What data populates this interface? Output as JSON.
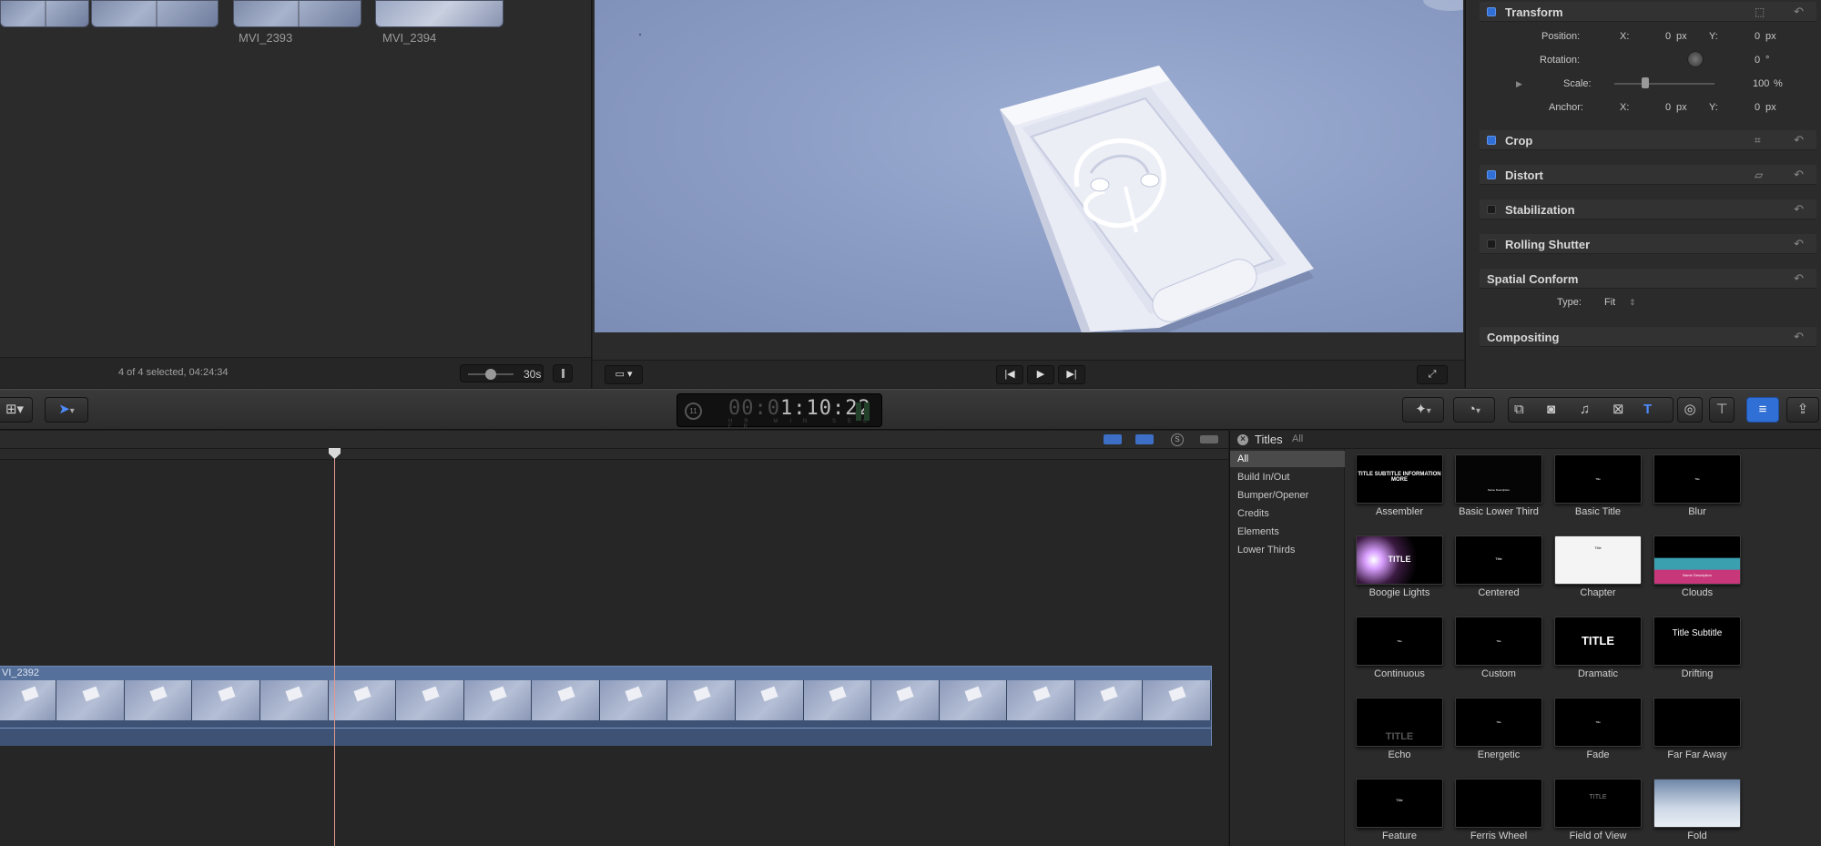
{
  "browser": {
    "clips": [
      {
        "name": ""
      },
      {
        "name": ""
      },
      {
        "name": "MVI_2393"
      },
      {
        "name": "MVI_2394"
      }
    ],
    "status": "4 of 4 selected, 04:24:34",
    "zoom_label": "30s"
  },
  "viewer": {
    "playback": {
      "prev": "|◀",
      "play": "▶",
      "next": "▶|"
    }
  },
  "inspector": {
    "transform": {
      "title": "Transform",
      "position_label": "Position:",
      "position_x_label": "X:",
      "position_x": "0",
      "position_x_unit": "px",
      "position_y_label": "Y:",
      "position_y": "0",
      "position_y_unit": "px",
      "rotation_label": "Rotation:",
      "rotation": "0",
      "rotation_unit": "°",
      "scale_label": "Scale:",
      "scale": "100",
      "scale_unit": "%",
      "anchor_label": "Anchor:",
      "anchor_x_label": "X:",
      "anchor_x": "0",
      "anchor_x_unit": "px",
      "anchor_y_label": "Y:",
      "anchor_y": "0",
      "anchor_y_unit": "px"
    },
    "crop": {
      "title": "Crop"
    },
    "distort": {
      "title": "Distort"
    },
    "stabilization": {
      "title": "Stabilization"
    },
    "rolling_shutter": {
      "title": "Rolling Shutter"
    },
    "spatial_conform": {
      "title": "Spatial Conform",
      "type_label": "Type:",
      "type_value": "Fit"
    },
    "compositing": {
      "title": "Compositing"
    },
    "reset_glyph": "↶"
  },
  "toolbar": {
    "timecode": "00:01:10:22",
    "timecode_dim": "00:0",
    "timecode_bright": "1:10:22",
    "timecode_units": "HR MIN SEC FR",
    "timecode_badge": "11"
  },
  "timeline": {
    "clip_name": "VI_2392"
  },
  "titles": {
    "heading": "Titles",
    "scope": "All",
    "categories": [
      "All",
      "Build In/Out",
      "Bumper/Opener",
      "Credits",
      "Elements",
      "Lower Thirds"
    ],
    "items": [
      {
        "name": "Assembler",
        "thumb_text": "TITLE SUBTITLE INFORMATION MORE"
      },
      {
        "name": "Basic Lower Third",
        "thumb_text": "Name Description"
      },
      {
        "name": "Basic Title",
        "thumb_text": "Title"
      },
      {
        "name": "Blur",
        "thumb_text": "Title"
      },
      {
        "name": "Boogie Lights",
        "thumb_text": "TITLE"
      },
      {
        "name": "Centered",
        "thumb_text": "Title"
      },
      {
        "name": "Chapter",
        "thumb_text": "Title"
      },
      {
        "name": "Clouds",
        "thumb_text": "Name Description"
      },
      {
        "name": "Continuous",
        "thumb_text": "Title"
      },
      {
        "name": "Custom",
        "thumb_text": "Title"
      },
      {
        "name": "Dramatic",
        "thumb_text": "TITLE"
      },
      {
        "name": "Drifting",
        "thumb_text": "Title Subtitle"
      },
      {
        "name": "Echo",
        "thumb_text": "TITLE"
      },
      {
        "name": "Energetic",
        "thumb_text": "Title"
      },
      {
        "name": "Fade",
        "thumb_text": "Title"
      },
      {
        "name": "Far Far Away",
        "thumb_text": ""
      },
      {
        "name": "Feature",
        "thumb_text": "Title"
      },
      {
        "name": "Ferris Wheel",
        "thumb_text": ""
      },
      {
        "name": "Field of View",
        "thumb_text": "TITLE"
      },
      {
        "name": "Fold",
        "thumb_text": ""
      }
    ]
  },
  "colors": {
    "accent": "#2f6fd6",
    "playhead": "#e49a8c",
    "clip_blue": "#4c6387"
  }
}
